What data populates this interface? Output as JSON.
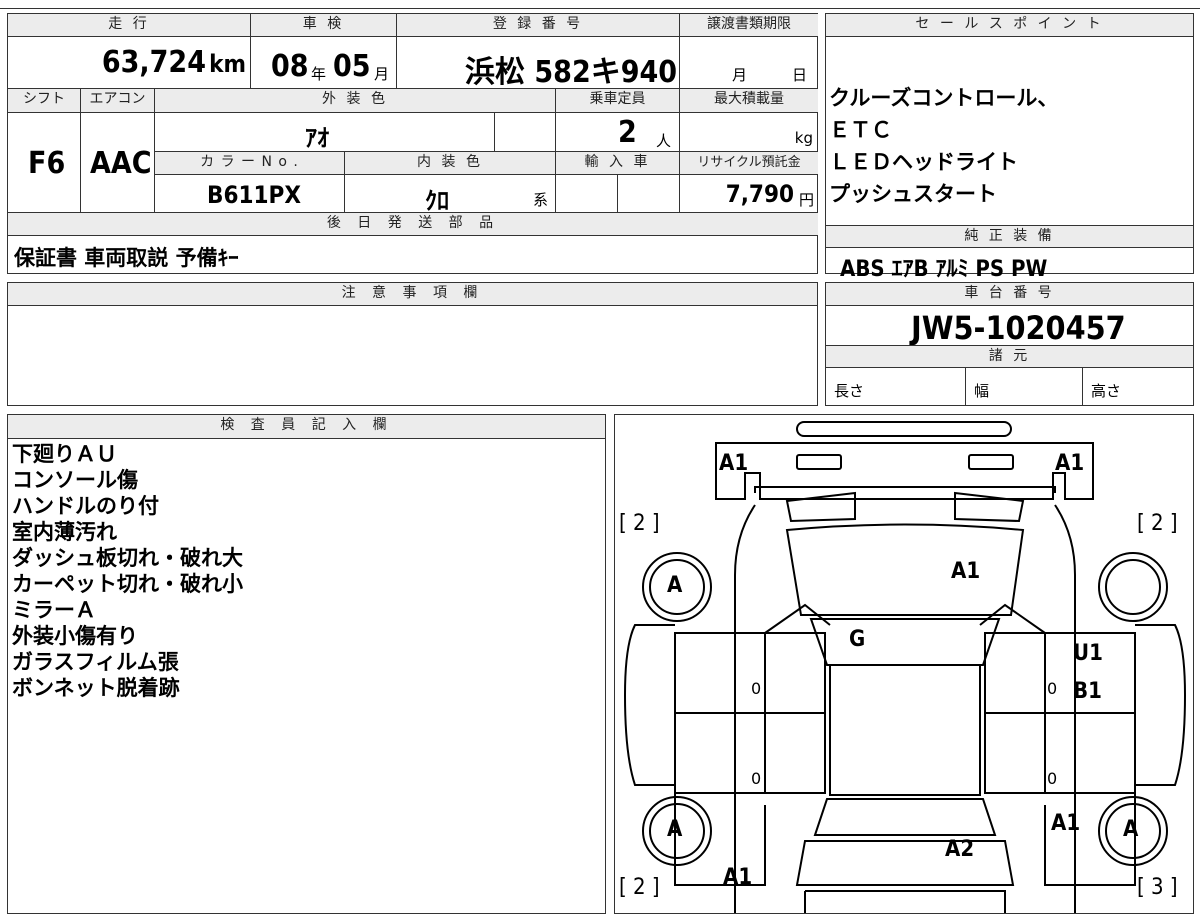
{
  "sheet": {
    "mileage_h": "走 行",
    "mileage": "63,724",
    "mileage_unit": "km",
    "inspection_h": "車 検",
    "insp_year": "08",
    "insp_year_unit": "年",
    "insp_month": "05",
    "insp_month_unit": "月",
    "reg_h": "登 録 番 号",
    "reg_number": "浜松 582キ940",
    "deadline_h": "譲渡書類期限",
    "deadline_month": "月",
    "deadline_day": "日",
    "shift_h": "シフト",
    "shift": "F6",
    "aircon_h": "エアコン",
    "aircon": "AAC",
    "exterior_h": "外 装 色",
    "exterior_color": "ｱｵ",
    "capacity_h": "乗車定員",
    "capacity": "2",
    "capacity_unit": "人",
    "maxload_h": "最大積載量",
    "maxload_unit": "kg",
    "color_no_h": "カ ラ ー N o .",
    "color_no": "B611PX",
    "interior_h": "内 装 色",
    "interior_color": "ｸﾛ",
    "interior_unit": "系",
    "import_h": "輸 入 車",
    "recycle_h": "リサイクル預託金",
    "recycle": "7,790",
    "recycle_unit": "円",
    "accessories_h": "後 日 発 送 部 品",
    "accessories": "保証書 車両取説 予備ｷｰ"
  },
  "sales": {
    "header": "セ ー ル ス ポ イ ン ト",
    "points": [
      "クルーズコントロール、",
      "ＥＴＣ",
      "ＬＥＤヘッドライト",
      "プッシュスタート"
    ],
    "equip_h": "純 正 装 備",
    "equipment": "ABS ｴｱB ｱﾙﾐ PS PW"
  },
  "notes": {
    "header": "注 意 事 項 欄"
  },
  "chassis": {
    "header": "車 台 番 号",
    "number": "JW5-1020457",
    "specs_h": "諸 元",
    "length": "長さ",
    "width": "幅",
    "height": "高さ"
  },
  "inspector": {
    "header": "検 査 員 記 入 欄",
    "items": [
      "下廻りＡＵ",
      "コンソール傷",
      "ハンドルのり付",
      "室内薄汚れ",
      "ダッシュ板切れ・破れ大",
      "カーペット切れ・破れ小",
      "ミラーＡ",
      "外装小傷有り",
      "ガラスフィルム張",
      "ボンネット脱着跡"
    ]
  },
  "diagram": {
    "a1_fl": "A1",
    "a1_fr": "A1",
    "br_left_top": "[ 2 ]",
    "br_right_top": "[ 2 ]",
    "wheel_fl": "A",
    "a1_hood": "A1",
    "g_windshield": "G",
    "u1": "U1",
    "b1": "B1",
    "zero_l1": "0",
    "zero_r1": "0",
    "zero_l2": "0",
    "zero_r2": "0",
    "wheel_rl": "A",
    "wheel_rr": "A",
    "a1_rr": "A1",
    "a2_rear": "A2",
    "a1_rear_left": "A1",
    "br_left_bot": "[ 2 ]",
    "br_right_bot": "[ 3 ]"
  }
}
